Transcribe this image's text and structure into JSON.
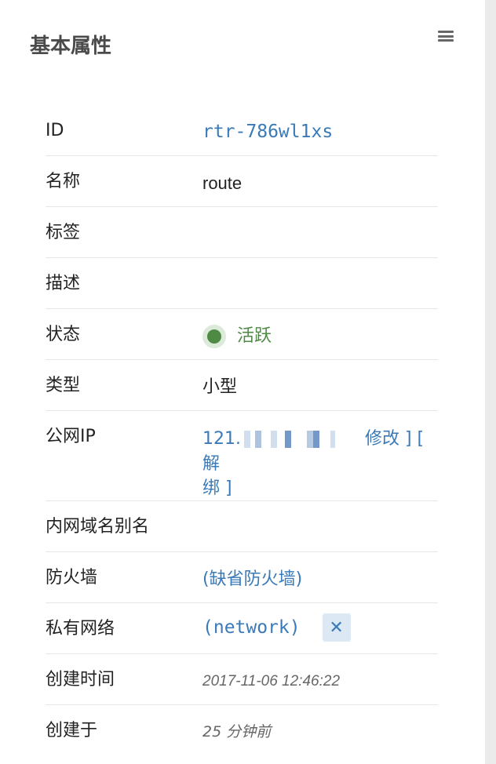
{
  "header": {
    "title": "基本属性",
    "menu_icon": "hamburger-menu-icon"
  },
  "rows": {
    "id": {
      "label": "ID",
      "value": "rtr-786wl1xs"
    },
    "name": {
      "label": "名称",
      "value": "route"
    },
    "tags": {
      "label": "标签",
      "value": ""
    },
    "description": {
      "label": "描述",
      "value": ""
    },
    "status": {
      "label": "状态",
      "value": "活跃",
      "color": "#4f8a45"
    },
    "type": {
      "label": "类型",
      "value": "小型"
    },
    "public_ip": {
      "label": "公网IP",
      "ip_prefix": "121.",
      "modify_link": "修改 ] [ 解",
      "unbind_link": "绑 ]"
    },
    "intranet_alias": {
      "label": "内网域名别名",
      "value": ""
    },
    "firewall": {
      "label": "防火墙",
      "value": "(缺省防火墙)"
    },
    "private_network": {
      "label": "私有网络",
      "value": "(network)",
      "remove_icon": "close-icon"
    },
    "created_time": {
      "label": "创建时间",
      "value": "2017-11-06 12:46:22"
    },
    "created_ago": {
      "label": "创建于",
      "value": "25 分钟前"
    }
  },
  "colors": {
    "link": "#3a7ab8",
    "status_green": "#4f8a45"
  }
}
